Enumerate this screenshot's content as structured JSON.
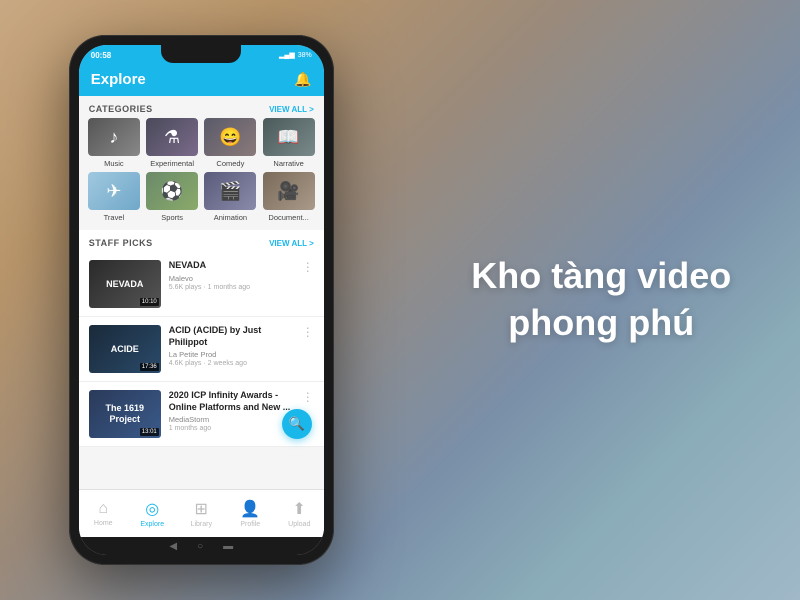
{
  "statusBar": {
    "time": "00:58",
    "battery": "38%"
  },
  "header": {
    "title": "Explore",
    "bellLabel": "🔔"
  },
  "categories": {
    "sectionTitle": "CATEGORIES",
    "viewAllLabel": "VIEW ALL >",
    "items": [
      {
        "id": "music",
        "label": "Music",
        "icon": "♪",
        "class": "music"
      },
      {
        "id": "experimental",
        "label": "Experimental",
        "icon": "🎭",
        "class": "experimental"
      },
      {
        "id": "comedy",
        "label": "Comedy",
        "icon": "🎪",
        "class": "comedy"
      },
      {
        "id": "narrative",
        "label": "Narrative",
        "icon": "📖",
        "class": "narrative"
      },
      {
        "id": "travel",
        "label": "Travel",
        "icon": "✈",
        "class": "travel"
      },
      {
        "id": "sports",
        "label": "Sports",
        "icon": "⚽",
        "class": "sports"
      },
      {
        "id": "animation",
        "label": "Animation",
        "icon": "🎬",
        "class": "animation"
      },
      {
        "id": "documentary",
        "label": "Document...",
        "icon": "🎥",
        "class": "documentary"
      }
    ]
  },
  "staffPicks": {
    "sectionTitle": "STAFF PICKS",
    "viewAllLabel": "VIEW ALL >",
    "videos": [
      {
        "id": "nevada",
        "title": "NEVADA",
        "author": "Malevo",
        "meta": "5.6K plays · 1 months ago",
        "duration": "10:10",
        "thumbClass": "nevada",
        "thumbText": "NEVADA"
      },
      {
        "id": "acide",
        "title": "ACID (ACIDE) by Just Philippot",
        "author": "La Petite Prod",
        "meta": "4.6K plays · 2 weeks ago",
        "duration": "17:36",
        "thumbClass": "acide",
        "thumbText": "ACIDE"
      },
      {
        "id": "icp",
        "title": "2020 ICP Infinity Awards - Online Platforms and New ...",
        "author": "MediaStorm",
        "meta": "1 months ago",
        "duration": "13:01",
        "thumbClass": "icp",
        "thumbText": "The 1619\nProject"
      }
    ]
  },
  "fab": {
    "icon": "🔍"
  },
  "bottomNav": {
    "items": [
      {
        "id": "home",
        "label": "Home",
        "icon": "⌂",
        "active": false
      },
      {
        "id": "explore",
        "label": "Explore",
        "icon": "◎",
        "active": true
      },
      {
        "id": "library",
        "label": "Library",
        "icon": "⊞",
        "active": false
      },
      {
        "id": "profile",
        "label": "Profile",
        "icon": "👤",
        "active": false
      },
      {
        "id": "upload",
        "label": "Upload",
        "icon": "↑",
        "active": false
      }
    ]
  },
  "rightText": {
    "line1": "Kho tàng video",
    "line2": "phong phú"
  }
}
